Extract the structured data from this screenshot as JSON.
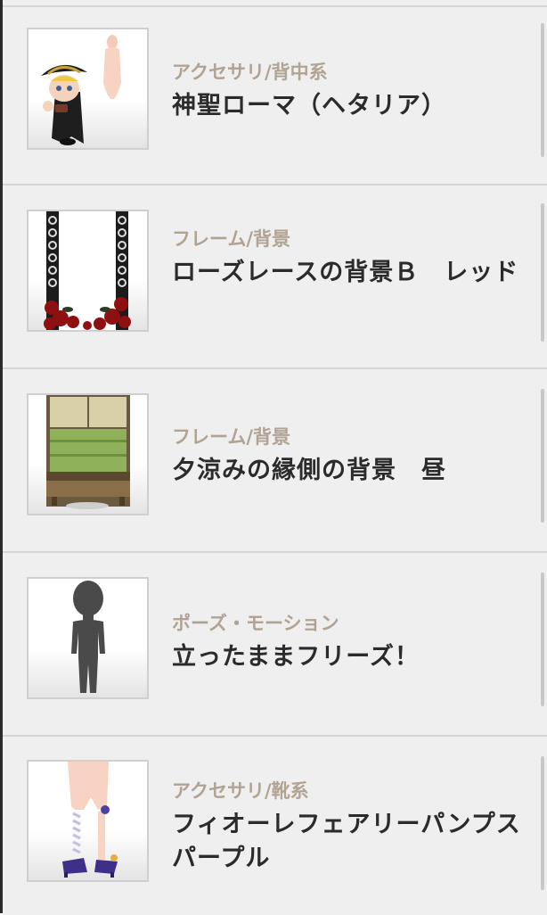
{
  "items": [
    {
      "category": "アクセサリ/背中系",
      "title": "神聖ローマ（ヘタリア）",
      "thumbnail_icon": "chibi-character-icon"
    },
    {
      "category": "フレーム/背景",
      "title": "ローズレースの背景Ｂ　レッド",
      "thumbnail_icon": "rose-lace-frame-icon"
    },
    {
      "category": "フレーム/背景",
      "title": "夕涼みの縁側の背景　昼",
      "thumbnail_icon": "veranda-background-icon"
    },
    {
      "category": "ポーズ・モーション",
      "title": "立ったままフリーズ！",
      "thumbnail_icon": "silhouette-pose-icon"
    },
    {
      "category": "アクセサリ/靴系",
      "title": "フィオーレフェアリーパンプス　パープル",
      "thumbnail_icon": "pumps-shoes-icon"
    }
  ],
  "colors": {
    "row_background": "#efefef",
    "category_text": "#b0a394",
    "title_text": "#2b2b2b",
    "separator": "#d4d4d4"
  }
}
